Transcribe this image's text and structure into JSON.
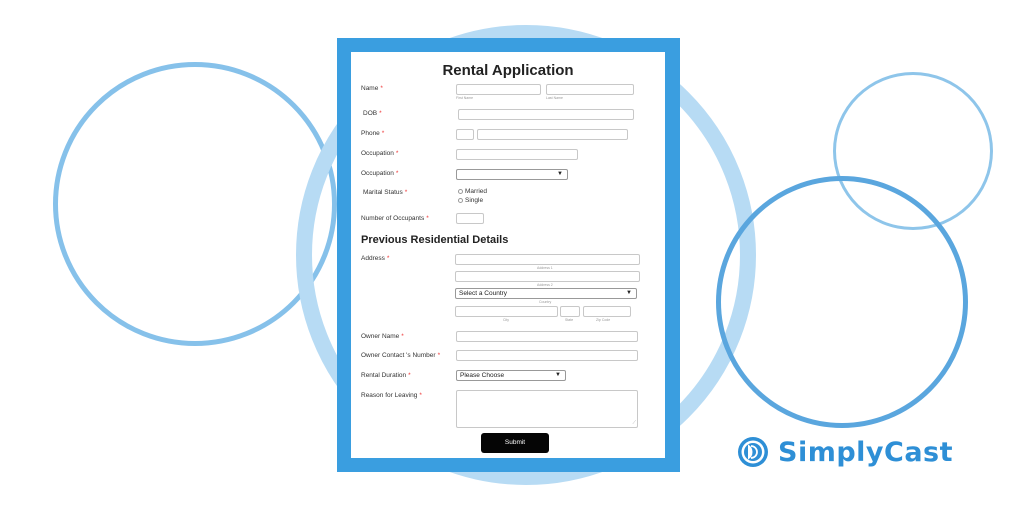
{
  "form": {
    "title": "Rental Application",
    "required_mark": "*",
    "name_label": "Name",
    "first_name_sub": "First Name",
    "last_name_sub": "Last Name",
    "dob_label": "DOB",
    "phone_label": "Phone",
    "occupation_label": "Occupation",
    "occupation2_label": "Occupation",
    "occupation2_value": "",
    "marital_label": "Marital Status",
    "marital_options": [
      "Married",
      "Single"
    ],
    "occupants_label": "Number of Occupants",
    "section_title": "Previous Residential Details",
    "address_label": "Address",
    "address1_sub": "Address 1",
    "address2_sub": "Address 2",
    "country_value": "Select a Country",
    "country_sub": "Country",
    "city_sub": "City",
    "state_sub": "State",
    "zip_sub": "Zip Code",
    "owner_name_label": "Owner Name",
    "owner_contact_label": "Owner Contact 's Number",
    "rental_duration_label": "Rental Duration",
    "rental_duration_value": "Please Choose",
    "reason_label": "Reason for Leaving",
    "submit_label": "Submit"
  },
  "brand": {
    "name": "SimplyCast",
    "logo_icon": "simplycast-logo-icon",
    "color": "#2e8fd6"
  },
  "colors": {
    "frame": "#3a9ee0",
    "required": "#e33333"
  }
}
